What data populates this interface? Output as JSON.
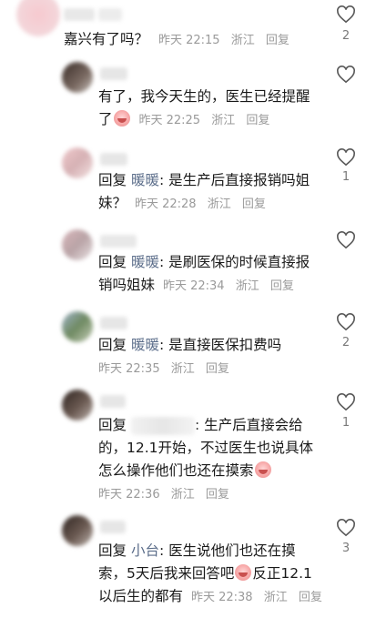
{
  "heart_icon": "heart-outline-icon",
  "colors": {
    "text": "#1a1a1a",
    "meta": "#9a9a9a",
    "mention": "#5b6d8a"
  },
  "comments": [
    {
      "text": "嘉兴有了吗？",
      "meta": {
        "time": "昨天 22:15",
        "loc": "浙江",
        "reply": "回复"
      },
      "likes": "2"
    },
    {
      "text_line1": "有了，我今天生的，医生已经提醒",
      "text_line2": "了",
      "meta": {
        "time": "昨天 22:25",
        "loc": "浙江",
        "reply": "回复"
      },
      "likes": ""
    },
    {
      "prefix": "回复",
      "mention": "暖暖",
      "text_line1": ": 是生产后直接报销吗姐",
      "text_line2": "妹？",
      "meta": {
        "time": "昨天 22:28",
        "loc": "浙江",
        "reply": "回复"
      },
      "likes": "1"
    },
    {
      "prefix": "回复",
      "mention": "暖暖",
      "text_line1": ": 是刷医保的时候直接报",
      "text_line2": "销吗姐妹",
      "meta": {
        "time": "昨天 22:34",
        "loc": "浙江",
        "reply": "回复"
      },
      "likes": ""
    },
    {
      "prefix": "回复",
      "mention": "暖暖",
      "text_line1": ": 是直接医保扣费吗",
      "meta": {
        "time": "昨天 22:35",
        "loc": "浙江",
        "reply": "回复"
      },
      "likes": "2"
    },
    {
      "prefix": "回复",
      "text_line1": ": 生产后直接会给",
      "text_line2": "的，12.1开始，不过医生也说具体",
      "text_line3": "怎么操作他们也还在摸索",
      "meta": {
        "time": "昨天 22:36",
        "loc": "浙江",
        "reply": "回复"
      },
      "likes": "1"
    },
    {
      "prefix": "回复",
      "mention": "小台",
      "text_line1": ": 医生说他们也还在摸",
      "text_line2a": "索，5天后我来回答吧",
      "text_line2b": "反正12.1",
      "text_line3": "以后生的都有",
      "meta": {
        "time": "昨天 22:38",
        "loc": "浙江",
        "reply": "回复"
      },
      "likes": "3"
    }
  ]
}
